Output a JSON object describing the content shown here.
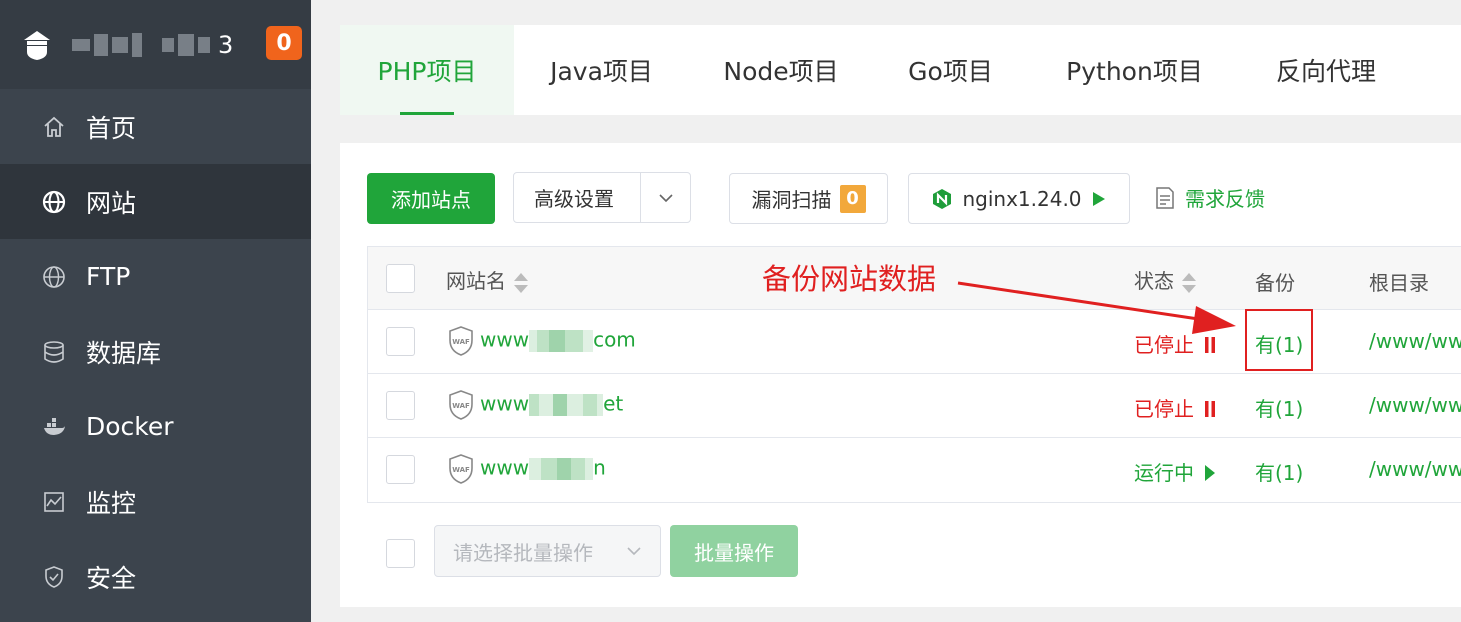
{
  "sidebar": {
    "host_tail": "3",
    "badge": "0",
    "items": [
      {
        "label": "首页",
        "icon": "home-icon"
      },
      {
        "label": "网站",
        "icon": "globe-icon"
      },
      {
        "label": "FTP",
        "icon": "ftp-globe-icon"
      },
      {
        "label": "数据库",
        "icon": "database-icon"
      },
      {
        "label": "Docker",
        "icon": "docker-icon"
      },
      {
        "label": "监控",
        "icon": "monitor-icon"
      },
      {
        "label": "安全",
        "icon": "shield-icon"
      }
    ]
  },
  "tabs": [
    "PHP项目",
    "Java项目",
    "Node项目",
    "Go项目",
    "Python项目",
    "反向代理"
  ],
  "toolbar": {
    "add_site": "添加站点",
    "advanced": "高级设置",
    "vuln_scan": "漏洞扫描",
    "vuln_count": "0",
    "nginx": "nginx1.24.0",
    "feedback": "需求反馈"
  },
  "table": {
    "headers": {
      "name": "网站名",
      "status": "状态",
      "backup": "备份",
      "root": "根目录"
    },
    "rows": [
      {
        "prefix": "www",
        "suffix": "com",
        "status": "已停止",
        "status_kind": "stopped",
        "backup": "有(1)",
        "root": "/www/ww"
      },
      {
        "prefix": "www",
        "suffix": "et",
        "status": "已停止",
        "status_kind": "stopped",
        "backup": "有(1)",
        "root": "/www/ww"
      },
      {
        "prefix": "www",
        "suffix": "n",
        "status": "运行中",
        "status_kind": "running",
        "backup": "有(1)",
        "root": "/www/ww"
      }
    ]
  },
  "bulk": {
    "placeholder": "请选择批量操作",
    "button": "批量操作"
  },
  "annotation": "备份网站数据",
  "colors": {
    "accent": "#20a53a",
    "danger": "#e02020",
    "sidebar": "#3c444d",
    "badge": "#f0641c"
  }
}
